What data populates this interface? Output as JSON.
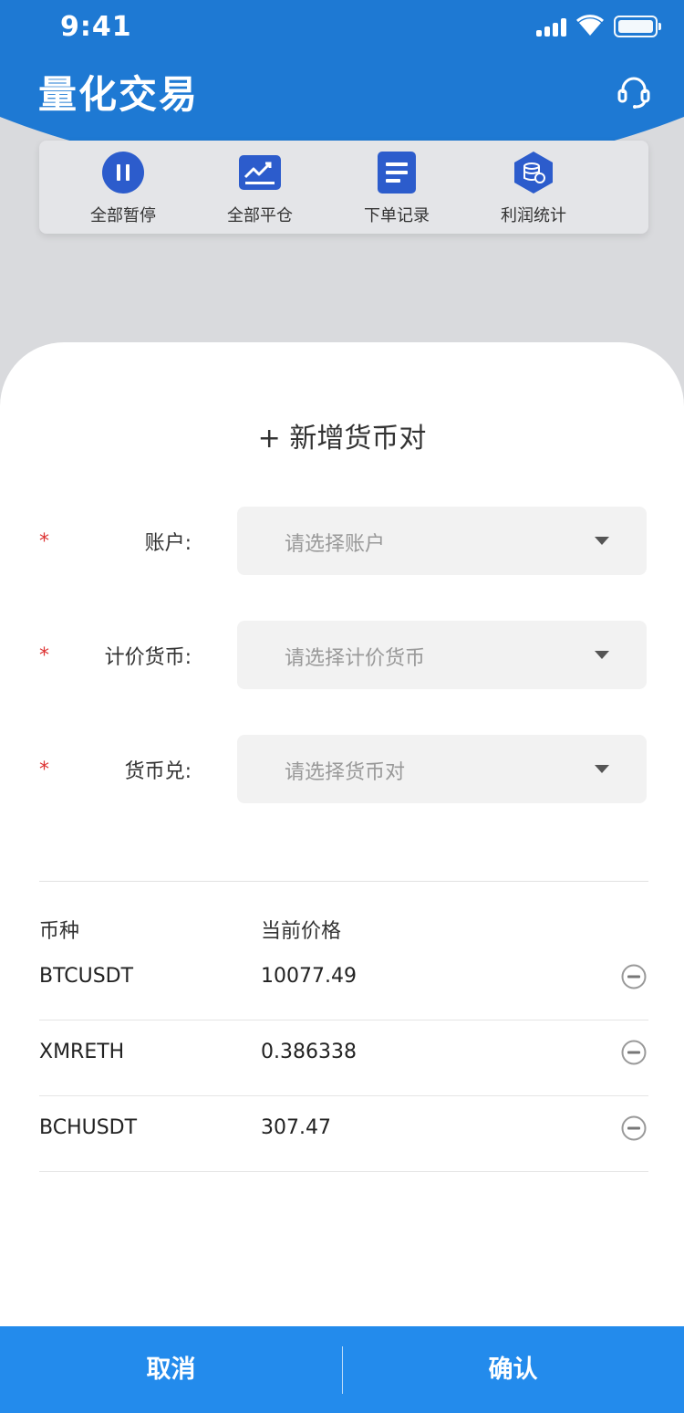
{
  "status_bar": {
    "time": "9:41"
  },
  "header": {
    "title": "量化交易",
    "support_icon": "headset-icon"
  },
  "quick_actions": [
    {
      "label": "全部暂停",
      "icon": "pause-icon"
    },
    {
      "label": "全部平仓",
      "icon": "chart-trend-icon"
    },
    {
      "label": "下单记录",
      "icon": "document-list-icon"
    },
    {
      "label": "利润统计",
      "icon": "coin-stack-icon"
    }
  ],
  "sheet": {
    "title": "+ 新增货币对",
    "fields": [
      {
        "label": "账户:",
        "placeholder": "请选择账户"
      },
      {
        "label": "计价货币:",
        "placeholder": "请选择计价货币"
      },
      {
        "label": "货币兑:",
        "placeholder": "请选择货币对"
      }
    ],
    "table": {
      "headers": [
        "币种",
        "当前价格"
      ],
      "rows": [
        {
          "symbol": "BTCUSDT",
          "price": "10077.49"
        },
        {
          "symbol": "XMRETH",
          "price": "0.386338"
        },
        {
          "symbol": "BCHUSDT",
          "price": "307.47"
        }
      ]
    }
  },
  "footer": {
    "cancel": "取消",
    "confirm": "确认"
  },
  "colors": {
    "primary": "#1e79d3",
    "footer": "#238bec",
    "icon": "#2c5ccc",
    "required": "#dd3333"
  }
}
